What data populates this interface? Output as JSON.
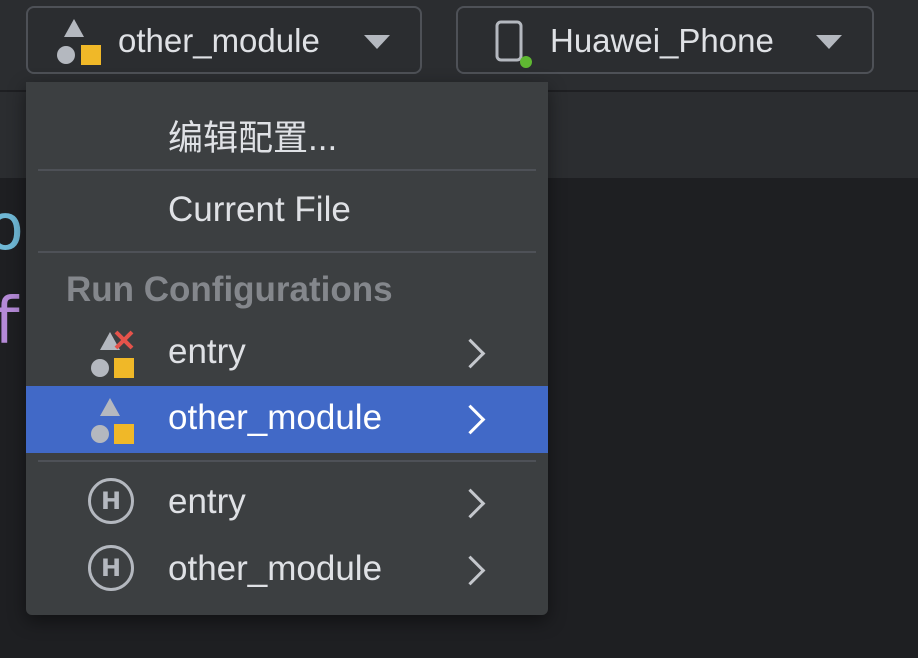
{
  "toolbar": {
    "run_config": {
      "label": "other_module",
      "icon": "module-icon"
    },
    "device": {
      "label": "Huawei_Phone",
      "icon": "phone-icon",
      "status_color": "#5fb832"
    }
  },
  "editor": {
    "line1": "o",
    "line2": "f"
  },
  "menu": {
    "edit_config": "编辑配置...",
    "current_file": "Current File",
    "section_header": "Run Configurations",
    "items": [
      {
        "label": "entry",
        "icon": "module-error-icon",
        "selected": false
      },
      {
        "label": "other_module",
        "icon": "module-icon",
        "selected": true
      },
      {
        "label": "entry",
        "icon": "h-icon",
        "selected": false
      },
      {
        "label": "other_module",
        "icon": "h-icon",
        "selected": false
      }
    ]
  },
  "colors": {
    "accent": "#4169c7",
    "icon_yellow": "#f0b828",
    "error_red": "#e5534b"
  }
}
